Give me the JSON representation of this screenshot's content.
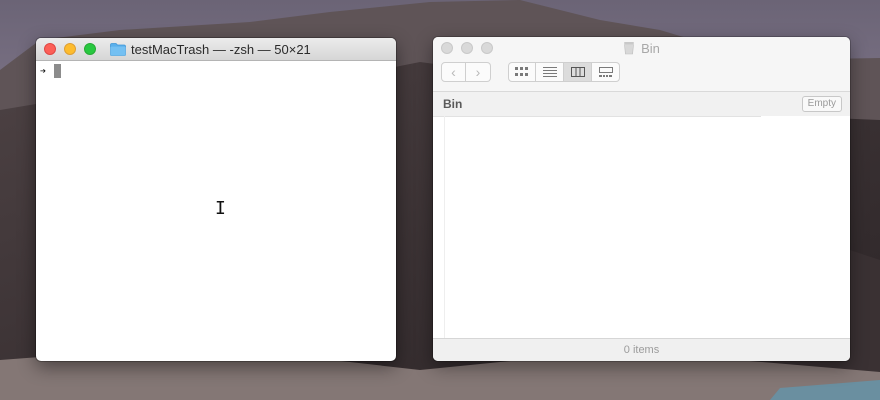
{
  "terminal": {
    "title": "testMacTrash — -zsh — 50×21",
    "prompt": "➔",
    "icons": {
      "folder": "folder-icon",
      "cursor": "i-beam-cursor"
    }
  },
  "finder": {
    "title": "Bin",
    "path_label": "Bin",
    "empty_button": "Empty",
    "status": "0 items",
    "nav": {
      "back": "‹",
      "forward": "›"
    },
    "views": [
      "icon-view",
      "list-view",
      "column-view",
      "gallery-view"
    ],
    "active_view": "column-view"
  },
  "colors": {
    "close": "#fc5f57",
    "minimize": "#fdbc2e",
    "maximize": "#28c840",
    "folder": "#5ab0ec"
  }
}
